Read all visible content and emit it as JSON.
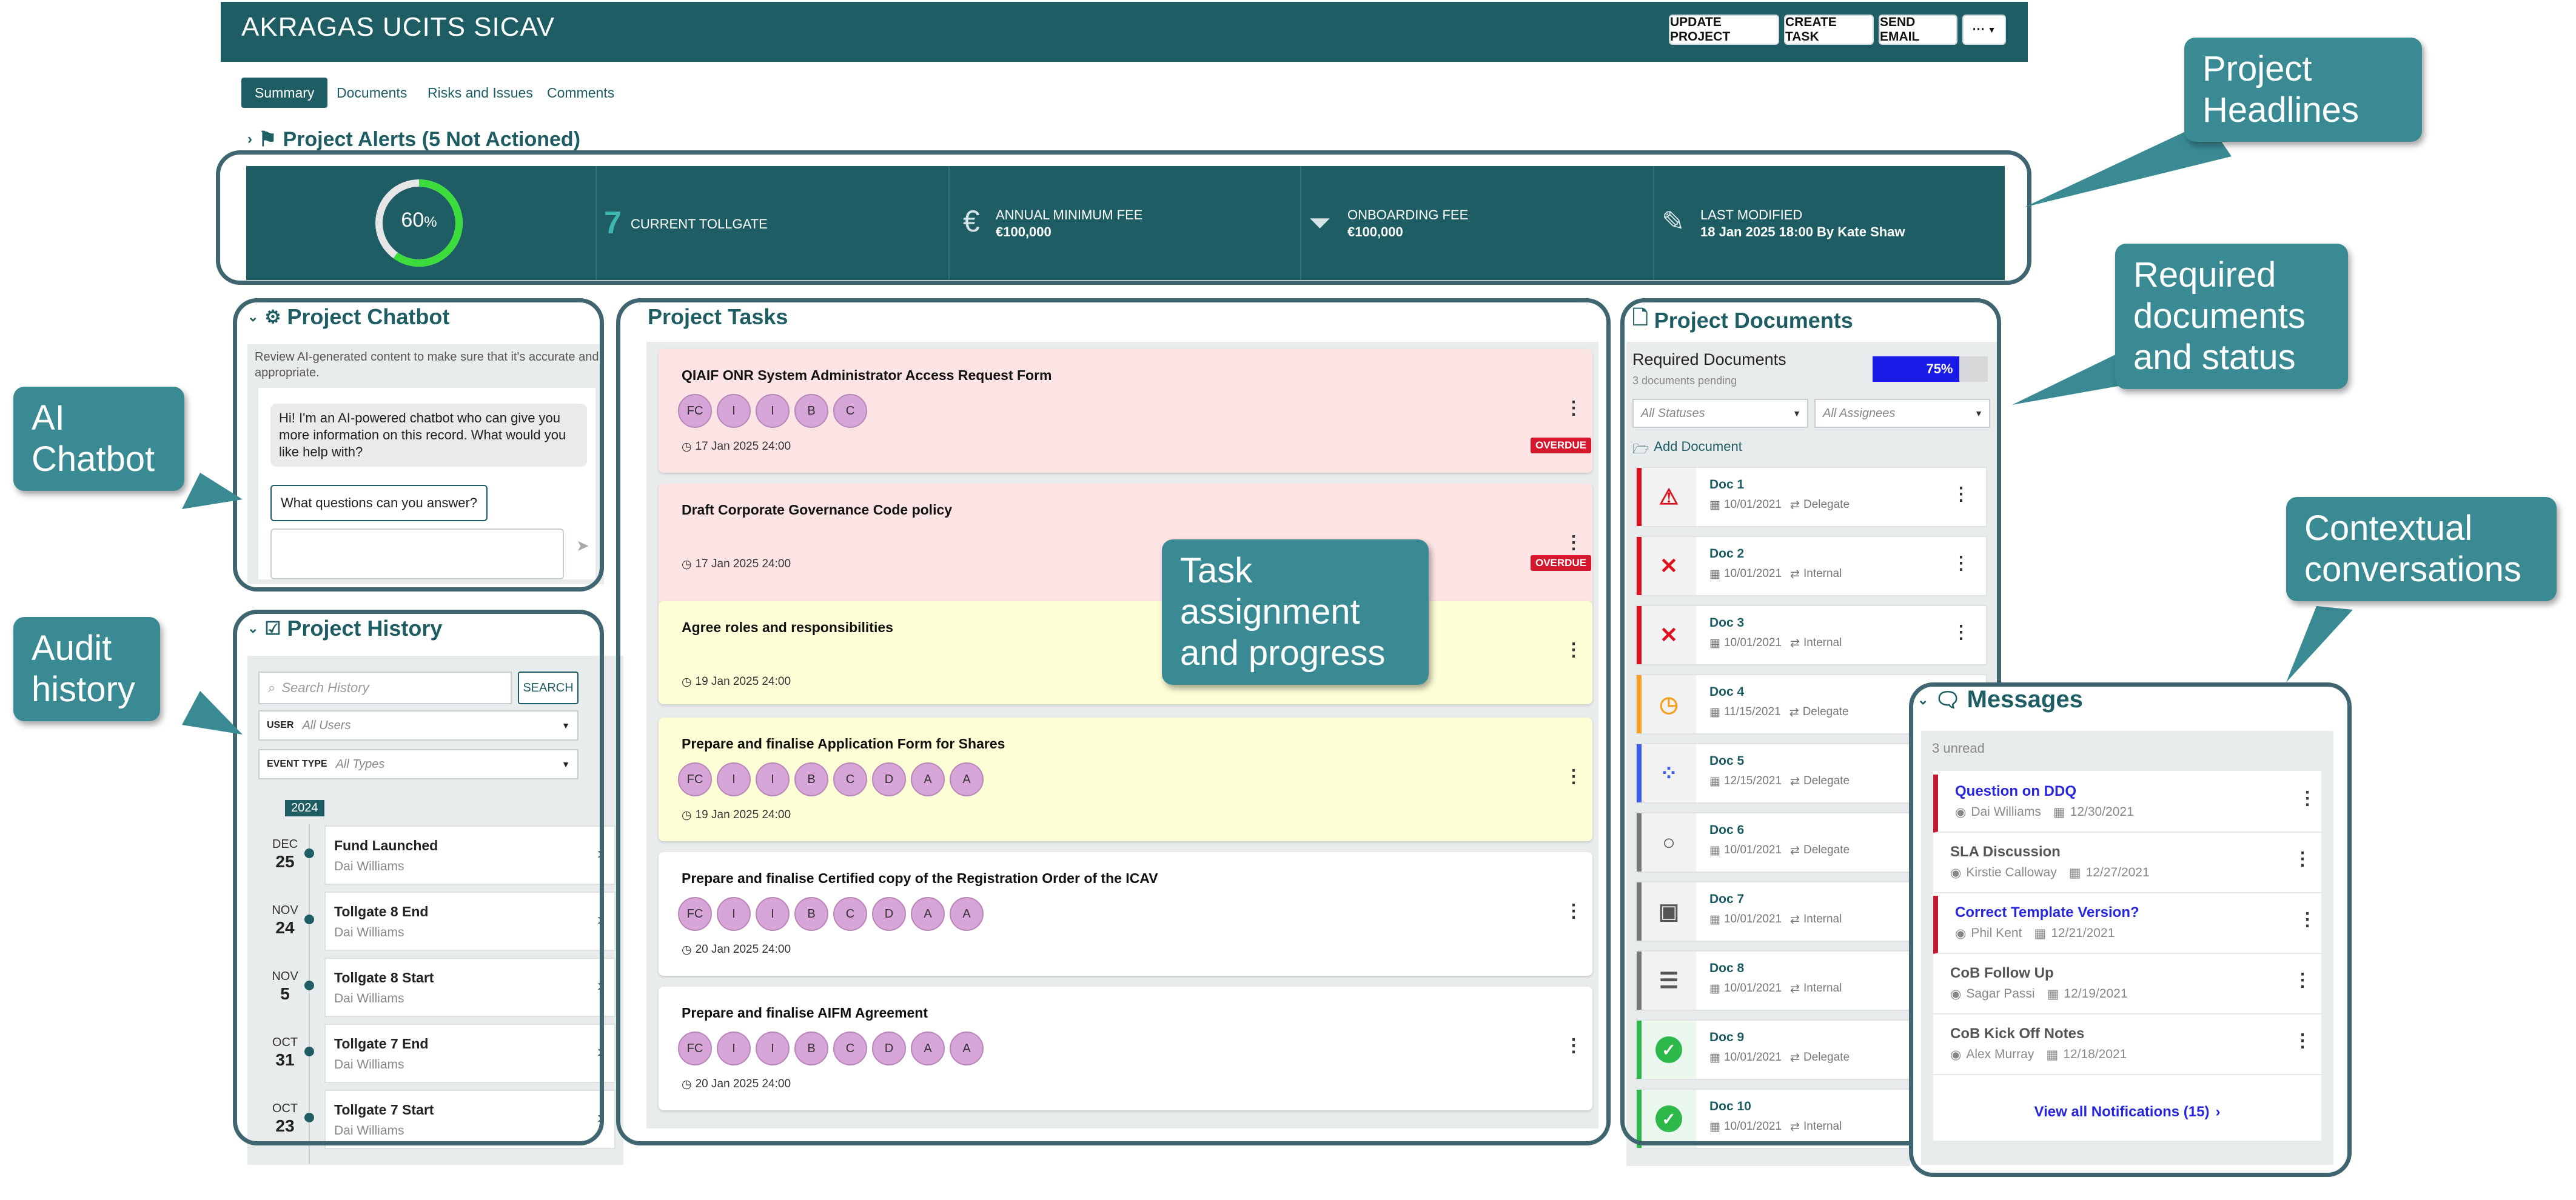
{
  "header": {
    "title": "AKRAGAS UCITS SICAV",
    "buttons": [
      "UPDATE PROJECT",
      "CREATE TASK",
      "SEND EMAIL",
      "···"
    ]
  },
  "tabs": [
    "Summary",
    "Documents",
    "Risks and Issues",
    "Comments"
  ],
  "alerts": {
    "title": "Project Alerts (5 Not Actioned)"
  },
  "headlines": {
    "progress_value": "60",
    "progress_unit": "%",
    "progress_fraction": 0.6,
    "tollgate_number": "7",
    "tollgate_label": "CURRENT TOLLGATE",
    "annual_fee_label": "ANNUAL MINIMUM FEE",
    "annual_fee_value": "€100,000",
    "onboarding_fee_label": "ONBOARDING FEE",
    "onboarding_fee_value": "€100,000",
    "modified_label": "LAST MODIFIED",
    "modified_value": "18 Jan 2025 18:00 By Kate Shaw"
  },
  "chatbot": {
    "title": "Project Chatbot",
    "disclaimer": "Review AI-generated content to make sure that it's accurate and appropriate.",
    "bot_message": "Hi! I'm an AI-powered chatbot who can give you more information on this record. What would you like help with?",
    "suggestion": "What questions can you answer?"
  },
  "history": {
    "title": "Project History",
    "search_placeholder": "Search History",
    "search_button": "SEARCH",
    "user_label": "USER",
    "user_value": "All Users",
    "event_label": "EVENT TYPE",
    "event_value": "All Types",
    "year": "2024",
    "items": [
      {
        "month": "DEC",
        "day": "25",
        "title": "Fund Launched",
        "user": "Dai Williams"
      },
      {
        "month": "NOV",
        "day": "24",
        "title": "Tollgate 8 End",
        "user": "Dai Williams"
      },
      {
        "month": "NOV",
        "day": "5",
        "title": "Tollgate 8 Start",
        "user": "Dai Williams"
      },
      {
        "month": "OCT",
        "day": "31",
        "title": "Tollgate 7 End",
        "user": "Dai Williams"
      },
      {
        "month": "OCT",
        "day": "23",
        "title": "Tollgate 7 Start",
        "user": "Dai Williams"
      }
    ]
  },
  "tasks": {
    "title": "Project Tasks",
    "overdue_label": "OVERDUE",
    "items": [
      {
        "title": "QIAIF ONR System Administrator Access Request Form",
        "avatars": [
          "FC",
          "I",
          "I",
          "B",
          "C"
        ],
        "date": "17 Jan 2025 24:00",
        "overdue": true,
        "color": "#fde4e4"
      },
      {
        "title": "Draft Corporate Governance Code policy",
        "avatars": [],
        "date": "17 Jan 2025 24:00",
        "overdue": true,
        "color": "#fde4e4"
      },
      {
        "title": "Agree roles and responsibilities",
        "avatars": [],
        "date": "19 Jan 2025 24:00",
        "overdue": false,
        "color": "#fdfdd6"
      },
      {
        "title": "Prepare and finalise Application Form for Shares",
        "avatars": [
          "FC",
          "I",
          "I",
          "B",
          "C",
          "D",
          "A",
          "A"
        ],
        "date": "19 Jan 2025 24:00",
        "overdue": false,
        "color": "#fdfdd6"
      },
      {
        "title": "Prepare and finalise Certified copy of the Registration Order of the ICAV",
        "avatars": [
          "FC",
          "I",
          "I",
          "B",
          "C",
          "D",
          "A",
          "A"
        ],
        "date": "20 Jan 2025 24:00",
        "overdue": false,
        "color": "#ffffff"
      },
      {
        "title": "Prepare and finalise AIFM Agreement",
        "avatars": [
          "FC",
          "I",
          "I",
          "B",
          "C",
          "D",
          "A",
          "A"
        ],
        "date": "20 Jan 2025 24:00",
        "overdue": false,
        "color": "#ffffff"
      }
    ]
  },
  "documents": {
    "title": "Project Documents",
    "required_label": "Required Documents",
    "pending": "3 documents pending",
    "progress": "75%",
    "progress_fraction": 0.75,
    "status_filter": "All Statuses",
    "assignee_filter": "All Assignees",
    "add_label": "Add Document",
    "items": [
      {
        "name": "Doc 1",
        "date": "10/01/2021",
        "type": "Delegate",
        "status_color": "#e0101e",
        "icon": "warning-icon",
        "glyph": "⚠",
        "glyph_color": "#e0101e"
      },
      {
        "name": "Doc 2",
        "date": "10/01/2021",
        "type": "Internal",
        "status_color": "#e0101e",
        "icon": "x-icon",
        "glyph": "✕",
        "glyph_color": "#e0101e"
      },
      {
        "name": "Doc 3",
        "date": "10/01/2021",
        "type": "Internal",
        "status_color": "#e0101e",
        "icon": "x-icon",
        "glyph": "✕",
        "glyph_color": "#e0101e"
      },
      {
        "name": "Doc 4",
        "date": "11/15/2021",
        "type": "Delegate",
        "status_color": "#f5a020",
        "icon": "clock-icon",
        "glyph": "◷",
        "glyph_color": "#f5a020"
      },
      {
        "name": "Doc 5",
        "date": "12/15/2021",
        "type": "Delegate",
        "status_color": "#3a5bf0",
        "icon": "spinner-icon",
        "glyph": "⁘",
        "glyph_color": "#3a5bf0"
      },
      {
        "name": "Doc 6",
        "date": "10/01/2021",
        "type": "Delegate",
        "status_color": "#777777",
        "icon": "circle-icon",
        "glyph": "○",
        "glyph_color": "#555555"
      },
      {
        "name": "Doc 7",
        "date": "10/01/2021",
        "type": "Internal",
        "status_color": "#777777",
        "icon": "robot-icon",
        "glyph": "▣",
        "glyph_color": "#555555"
      },
      {
        "name": "Doc 8",
        "date": "10/01/2021",
        "type": "Internal",
        "status_color": "#777777",
        "icon": "list-icon",
        "glyph": "☰",
        "glyph_color": "#555555"
      },
      {
        "name": "Doc 9",
        "date": "10/01/2021",
        "type": "Delegate",
        "status_color": "#2db84a",
        "icon": "check-icon",
        "glyph": "✓",
        "glyph_color": "#ffffff"
      },
      {
        "name": "Doc 10",
        "date": "10/01/2021",
        "type": "Internal",
        "status_color": "#2db84a",
        "icon": "check-icon",
        "glyph": "✓",
        "glyph_color": "#ffffff"
      }
    ]
  },
  "messages": {
    "title": "Messages",
    "unread": "3 unread",
    "view_all": "View all Notifications (15)",
    "items": [
      {
        "subject": "Question on DDQ",
        "user": "Dai Williams",
        "date": "12/30/2021",
        "unread": true
      },
      {
        "subject": "SLA Discussion",
        "user": "Kirstie Calloway",
        "date": "12/27/2021",
        "unread": false
      },
      {
        "subject": "Correct Template Version?",
        "user": "Phil Kent",
        "date": "12/21/2021",
        "unread": true
      },
      {
        "subject": "CoB Follow Up",
        "user": "Sagar Passi",
        "date": "12/19/2021",
        "unread": false
      },
      {
        "subject": "CoB Kick Off Notes",
        "user": "Alex Murray",
        "date": "12/18/2021",
        "unread": false
      }
    ]
  },
  "callouts": {
    "headlines": "Project Headlines",
    "required_docs": "Required documents and status",
    "chatbot": "AI Chatbot",
    "audit": "Audit history",
    "tasks": "Task assignment and progress",
    "conversations": "Contextual conversations"
  },
  "colors": {
    "primary": "#1d5d63",
    "callout": "#3a8a93",
    "overdue": "#d4192e",
    "progress_green": "#3ddc3d",
    "doc_progress": "#1a1ae6",
    "link_blue": "#2626e0"
  }
}
